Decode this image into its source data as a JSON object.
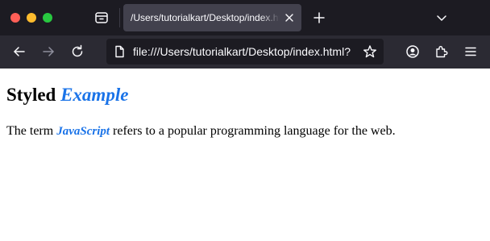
{
  "browser": {
    "tab": {
      "title": "/Users/tutorialkart/Desktop/index.html"
    },
    "address_bar": {
      "url": "file:///Users/tutorialkart/Desktop/index.html?"
    },
    "icons": {
      "tab_manager": "tab-manager-icon",
      "close_tab": "close-icon",
      "new_tab": "plus-icon",
      "list_tabs": "chevron-down-icon",
      "back": "back-arrow-icon",
      "forward": "forward-arrow-icon",
      "reload": "reload-icon",
      "page": "page-icon",
      "bookmark": "star-icon",
      "account": "account-icon",
      "extensions": "puzzle-icon",
      "menu": "hamburger-menu-icon"
    },
    "colors": {
      "tabstrip_bg": "#1c1b22",
      "navbar_bg": "#2b2a33",
      "active_tab_bg": "#42414d"
    }
  },
  "page": {
    "heading": {
      "prefix": "Styled ",
      "emphasis": "Example"
    },
    "paragraph": {
      "prefix": "The term ",
      "emphasis": "JavaScript",
      "suffix": " refers to a popular programming language for the web."
    },
    "accent_color": "#1a73e8"
  }
}
